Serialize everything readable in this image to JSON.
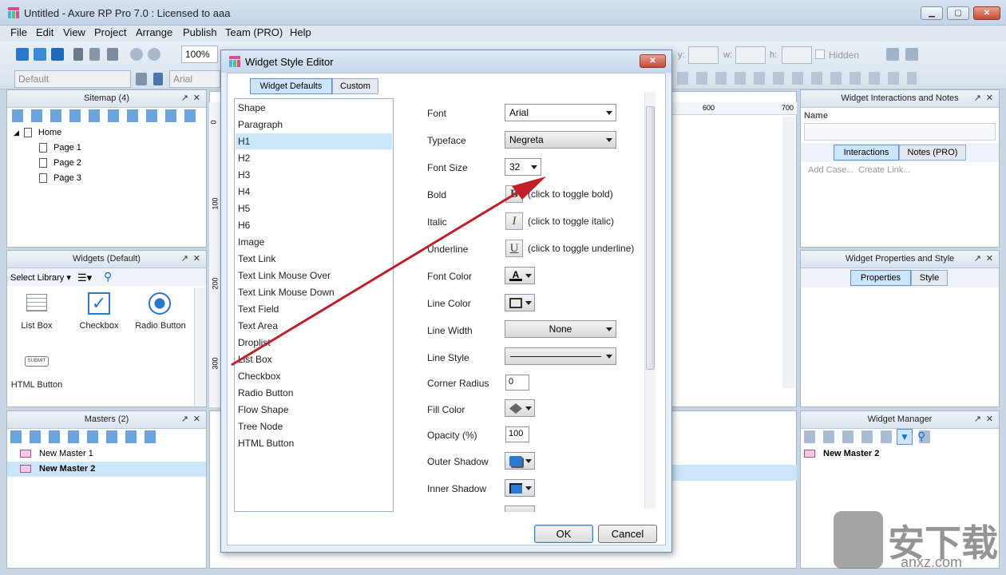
{
  "app": {
    "title": "Untitled - Axure RP Pro 7.0 : Licensed to aaa",
    "window_controls": {
      "min": "▁",
      "max": "▢",
      "close": "✕"
    }
  },
  "menu": [
    "File",
    "Edit",
    "View",
    "Project",
    "Arrange",
    "Publish",
    "Team (PRO)",
    "Help"
  ],
  "toolbar": {
    "zoom": "100%",
    "style_select": "Default",
    "font_select": "Arial",
    "coord_labels": {
      "y": "y:",
      "w": "w:",
      "h": "h:"
    },
    "hidden_label": "Hidden"
  },
  "sitemap": {
    "title": "Sitemap (4)",
    "items": [
      {
        "label": "Home"
      },
      {
        "label": "Page 1"
      },
      {
        "label": "Page 2"
      },
      {
        "label": "Page 3"
      }
    ]
  },
  "widgets_panel": {
    "title": "Widgets (Default)",
    "select_library": "Select Library",
    "items": [
      "List Box",
      "Checkbox",
      "Radio Button",
      "HTML Button"
    ],
    "submit_text": "SUBMIT"
  },
  "masters": {
    "title": "Masters (2)",
    "items": [
      {
        "label": "New Master 1",
        "selected": false
      },
      {
        "label": "New Master 2",
        "selected": true
      }
    ]
  },
  "canvas": {
    "ruler_top": [
      "600",
      "700"
    ],
    "ruler_left": [
      "0",
      "100",
      "200",
      "300"
    ]
  },
  "interactions_panel": {
    "title": "Widget Interactions and Notes",
    "name_label": "Name",
    "tabs": [
      "Interactions",
      "Notes (PRO)"
    ],
    "links": [
      "Add Case...",
      "Create Link..."
    ]
  },
  "properties_panel": {
    "title": "Widget Properties and Style",
    "tabs": [
      "Properties",
      "Style"
    ]
  },
  "widget_manager": {
    "title": "Widget Manager",
    "item": "New Master 2"
  },
  "dialog": {
    "title": "Widget Style Editor",
    "close": "✕",
    "tabs": [
      "Widget Defaults",
      "Custom"
    ],
    "styles": [
      "Shape",
      "Paragraph",
      "H1",
      "H2",
      "H3",
      "H4",
      "H5",
      "H6",
      "Image",
      "Text Link",
      "Text Link Mouse Over",
      "Text Link Mouse Down",
      "Text Field",
      "Text Area",
      "Droplist",
      "List Box",
      "Checkbox",
      "Radio Button",
      "Flow Shape",
      "Tree Node",
      "HTML Button"
    ],
    "selected_style": "H1",
    "props": {
      "font_label": "Font",
      "font_value": "Arial",
      "typeface_label": "Typeface",
      "typeface_value": "Negreta",
      "fontsize_label": "Font Size",
      "fontsize_value": "32",
      "bold_label": "Bold",
      "bold_glyph": "B",
      "bold_hint": "(click to toggle bold)",
      "italic_label": "Italic",
      "italic_glyph": "I",
      "italic_hint": "(click to toggle italic)",
      "underline_label": "Underline",
      "underline_glyph": "U",
      "underline_hint": "(click to toggle underline)",
      "fontcolor_label": "Font Color",
      "linecolor_label": "Line Color",
      "linewidth_label": "Line Width",
      "linewidth_value": "None",
      "linestyle_label": "Line Style",
      "corner_label": "Corner Radius",
      "corner_value": "0",
      "fill_label": "Fill Color",
      "opacity_label": "Opacity (%)",
      "opacity_value": "100",
      "outer_label": "Outer Shadow",
      "inner_label": "Inner Shadow"
    },
    "ok": "OK",
    "cancel": "Cancel"
  },
  "watermark": {
    "text": "安下载",
    "sub": "anxz.com"
  },
  "colors": {
    "accent": "#c0202a",
    "selection": "#cbe6f8",
    "master_icon": "#f2c7e2"
  }
}
